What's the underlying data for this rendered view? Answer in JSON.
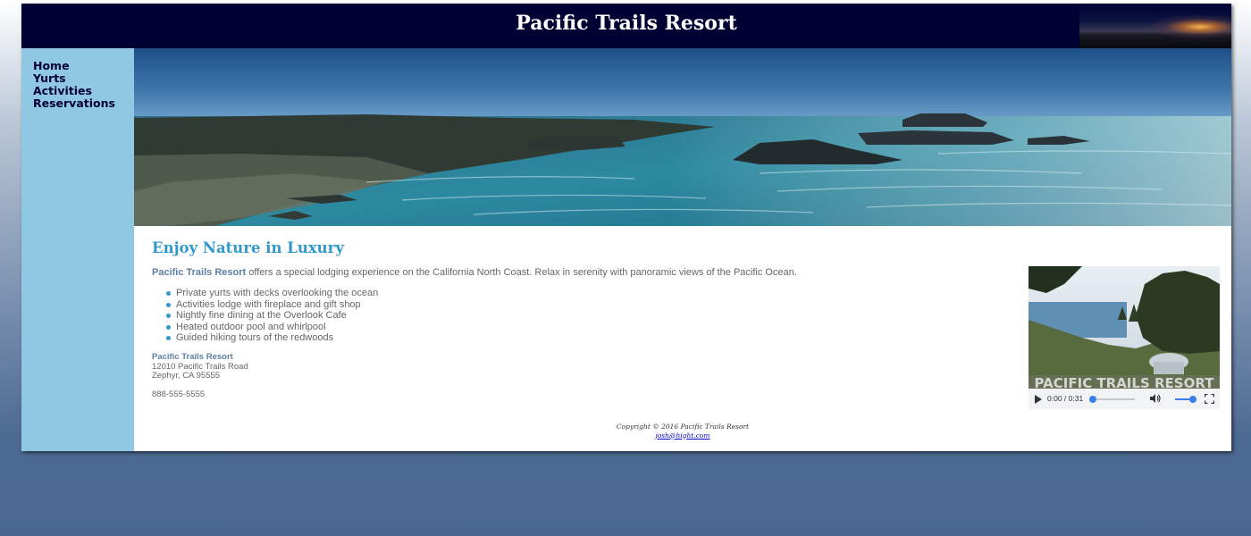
{
  "header": {
    "title": "Pacific Trails Resort"
  },
  "nav": {
    "items": [
      {
        "label": "Home"
      },
      {
        "label": "Yurts"
      },
      {
        "label": "Activities"
      },
      {
        "label": "Reservations"
      }
    ]
  },
  "main": {
    "heading": "Enjoy Nature in Luxury",
    "intro_brand": "Pacific Trails Resort",
    "intro_text": " offers a special lodging experience on the California North Coast. Relax in serenity with panoramic views of the Pacific Ocean.",
    "features": [
      "Private yurts with decks overlooking the ocean",
      "Activities lodge with fireplace and gift shop",
      "Nightly fine dining at the Overlook Cafe",
      "Heated outdoor pool and whirlpool",
      "Guided hiking tours of the redwoods"
    ],
    "contact": {
      "name": "Pacific Trails Resort",
      "street": "12010 Pacific Trails Road",
      "city": "Zephyr, CA 95555",
      "phone": "888-555-5555"
    },
    "video": {
      "overlay_text": "PACIFIC TRAILS RESORT",
      "time": "0:00 / 0:31",
      "progress": 0,
      "volume": 1
    }
  },
  "footer": {
    "copyright": "Copyright © 2016 Pacific Trails Resort",
    "email": "josh@hight.com"
  },
  "colors": {
    "header_bg": "#000033",
    "nav_bg": "#90c7e3",
    "heading": "#3399cc",
    "accent_link": "#5c7fa3"
  }
}
